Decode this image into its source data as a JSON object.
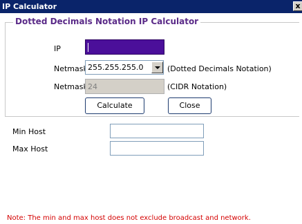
{
  "window": {
    "title": "IP Calculator",
    "close_glyph": "x"
  },
  "group": {
    "title": "Dotted Decimals Notation IP Calculator"
  },
  "form": {
    "ip_label": "IP",
    "ip_value": "",
    "netmask_label": "Netmask",
    "netmask_selected": "255.255.255.0",
    "netmask_dotted_note": "(Dotted Decimals Notation)",
    "netmask_cidr_label": "Netmask",
    "netmask_cidr_value": "24",
    "netmask_cidr_note": "(CIDR Notation)",
    "calculate_label": "Calculate",
    "close_label": "Close"
  },
  "results": {
    "min_host_label": "Min Host",
    "min_host_value": "",
    "max_host_label": "Max Host",
    "max_host_value": ""
  },
  "note": "Note: The min and max host does not exclude broadcast and network.",
  "colors": {
    "title_bar": "#0a246a",
    "group_title": "#5a2a88",
    "ip_field": "#4b0f9a",
    "note": "#d40000"
  }
}
